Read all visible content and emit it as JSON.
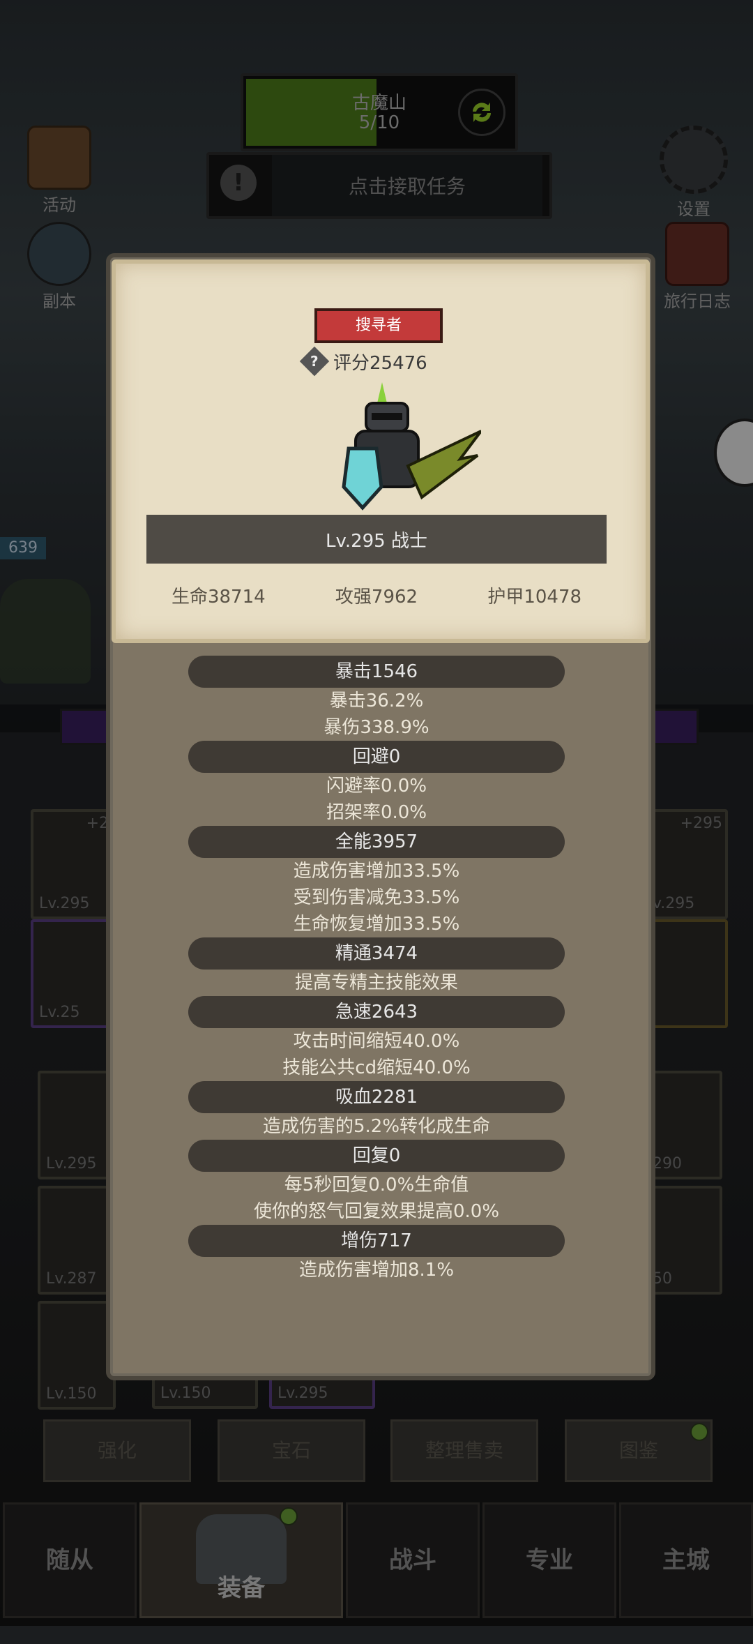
{
  "hud": {
    "zone_name": "古魔山",
    "zone_progress": "5/10",
    "progress_fraction": 0.5,
    "task_label": "点击接取任务",
    "left_buttons": [
      {
        "label": "活动",
        "icon": "scroll-icon"
      },
      {
        "label": "副本",
        "icon": "portal-icon"
      }
    ],
    "right_buttons": [
      {
        "label": "设置",
        "icon": "gear-icon"
      },
      {
        "label": "旅行日志",
        "icon": "book-icon"
      }
    ],
    "side_number": "639"
  },
  "character": {
    "title_badge": "搜寻者",
    "score_label": "评分25476",
    "level_class": "Lv.295 战士",
    "hp": "生命38714",
    "attack": "攻强7962",
    "armor": "护甲10478"
  },
  "stats": [
    {
      "header": "暴击1546",
      "lines": [
        "暴击36.2%",
        "暴伤338.9%"
      ]
    },
    {
      "header": "回避0",
      "lines": [
        "闪避率0.0%",
        "招架率0.0%"
      ]
    },
    {
      "header": "全能3957",
      "lines": [
        "造成伤害增加33.5%",
        "受到伤害减免33.5%",
        "生命恢复增加33.5%"
      ]
    },
    {
      "header": "精通3474",
      "lines": [
        "提高专精主技能效果"
      ]
    },
    {
      "header": "急速2643",
      "lines": [
        "攻击时间缩短40.0%",
        "技能公共cd缩短40.0%"
      ]
    },
    {
      "header": "吸血2281",
      "lines": [
        "造成伤害的5.2%转化成生命"
      ]
    },
    {
      "header": "回复0",
      "lines": [
        "每5秒回复0.0%生命值",
        "使你的怒气回复效果提高0.0%"
      ]
    },
    {
      "header": "增伤717",
      "lines": [
        "造成伤害增加8.1%"
      ]
    }
  ],
  "inventory": {
    "top_left_plus": "+2",
    "top_left_lv": "Lv.295",
    "mid_left_lv": "Lv.25",
    "top_right_plus": "+295",
    "top_right_lv": "v.295",
    "grid_lv": [
      "Lv.295",
      "Lv.287",
      "Lv.150",
      "Lv.150",
      "Lv.295"
    ],
    "right_lv": [
      "290",
      "50"
    ]
  },
  "actions": [
    "强化",
    "宝石",
    "整理售卖",
    "图鉴"
  ],
  "tabs": [
    "随从",
    "装备",
    "战斗",
    "专业",
    "主城"
  ]
}
